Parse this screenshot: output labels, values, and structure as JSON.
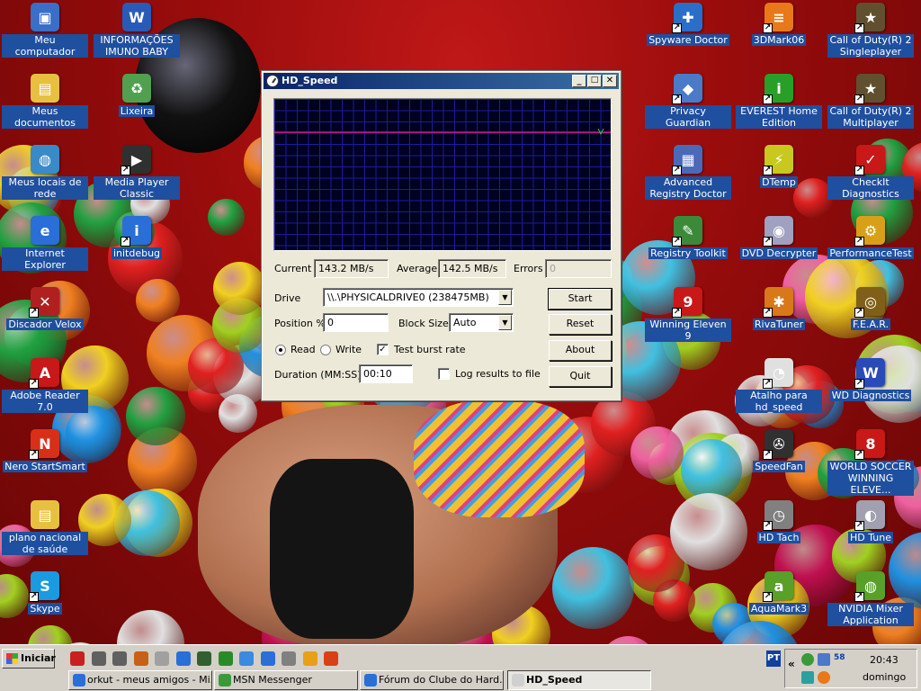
{
  "window": {
    "title": "HD_Speed",
    "btn_min": "_",
    "btn_max": "□",
    "btn_close": "✕",
    "current_label": "Current",
    "current_value": "143.2 MB/s",
    "average_label": "Average",
    "average_value": "142.5 MB/s",
    "errors_label": "Errors",
    "errors_value": "0",
    "drive_label": "Drive",
    "drive_value": "\\\\.\\PHYSICALDRIVE0 (238475MB)",
    "position_label": "Position %",
    "position_value": "0",
    "blocksize_label": "Block Size",
    "blocksize_value": "Auto",
    "read_label": "Read",
    "write_label": "Write",
    "burst_label": "Test burst rate",
    "duration_label": "Duration (MM:SS)",
    "duration_value": "00:10",
    "log_label": "Log results to file",
    "start_label": "Start",
    "reset_label": "Reset",
    "about_label": "About",
    "quit_label": "Quit",
    "mode_selected": "Read",
    "burst_checked": true,
    "log_checked": false,
    "graph_line_color": "#d01880",
    "graph_bg_color": "#000020",
    "graph_grid_color": "#1c1c9a"
  },
  "desktop_left": [
    {
      "label": "Meu computador",
      "icon": "computer-icon",
      "color": "#3a6ec8",
      "glyph": "▣",
      "shortcut": false
    },
    {
      "label": "Meus documentos",
      "icon": "folder-icon",
      "color": "#e8c040",
      "glyph": "▤",
      "shortcut": false
    },
    {
      "label": "Meus locais de rede",
      "icon": "network-icon",
      "color": "#3a8ac8",
      "glyph": "◍",
      "shortcut": false
    },
    {
      "label": "Internet Explorer",
      "icon": "internet-explorer-icon",
      "color": "#2a6ed8",
      "glyph": "e",
      "shortcut": false
    },
    {
      "label": "Discador Velox",
      "icon": "dialer-icon",
      "color": "#b02020",
      "glyph": "✕",
      "shortcut": true
    },
    {
      "label": "Adobe Reader 7.0",
      "icon": "adobe-reader-icon",
      "color": "#c81818",
      "glyph": "A",
      "shortcut": true
    },
    {
      "label": "Nero StartSmart",
      "icon": "nero-icon",
      "color": "#d83018",
      "glyph": "N",
      "shortcut": true
    },
    {
      "label": "plano nacional de saúde",
      "icon": "folder-icon",
      "color": "#e8c040",
      "glyph": "▤",
      "shortcut": false
    },
    {
      "label": "Skype",
      "icon": "skype-icon",
      "color": "#1a9ae0",
      "glyph": "S",
      "shortcut": true
    }
  ],
  "desktop_col2": [
    {
      "label": "INFORMAÇÕES IMUNO BABY",
      "icon": "word-document-icon",
      "color": "#2a5ab8",
      "glyph": "W",
      "shortcut": false
    },
    {
      "label": "Lixeira",
      "icon": "recycle-bin-icon",
      "color": "#50a050",
      "glyph": "♻",
      "shortcut": false
    },
    {
      "label": "Media Player Classic",
      "icon": "media-player-icon",
      "color": "#303030",
      "glyph": "▶",
      "shortcut": true
    },
    {
      "label": "initdebug",
      "icon": "info-icon",
      "color": "#2a6ed8",
      "glyph": "i",
      "shortcut": true
    }
  ],
  "desktop_right1": [
    {
      "label": "Spyware Doctor",
      "icon": "spyware-doctor-icon",
      "color": "#2a6ec8",
      "glyph": "✚",
      "shortcut": true
    },
    {
      "label": "Privacy Guardian",
      "icon": "privacy-guardian-icon",
      "color": "#4a7ac8",
      "glyph": "◆",
      "shortcut": true
    },
    {
      "label": "Advanced Registry Doctor",
      "icon": "registry-doctor-icon",
      "color": "#4a6ab8",
      "glyph": "▦",
      "shortcut": true
    },
    {
      "label": "Registry Toolkit",
      "icon": "registry-toolkit-icon",
      "color": "#3a8a3a",
      "glyph": "✎",
      "shortcut": true
    },
    {
      "label": "Winning Eleven 9",
      "icon": "winning-eleven-icon",
      "color": "#c81818",
      "glyph": "9",
      "shortcut": true
    }
  ],
  "desktop_right2": [
    {
      "label": "3DMark06",
      "icon": "3dmark-icon",
      "color": "#e87818",
      "glyph": "≡",
      "shortcut": true
    },
    {
      "label": "EVEREST Home Edition",
      "icon": "everest-icon",
      "color": "#28a028",
      "glyph": "i",
      "shortcut": true
    },
    {
      "label": "DTemp",
      "icon": "dtemp-icon",
      "color": "#c8c820",
      "glyph": "⚡",
      "shortcut": true
    },
    {
      "label": "DVD Decrypter",
      "icon": "dvd-decrypter-icon",
      "color": "#a0a0c0",
      "glyph": "◉",
      "shortcut": true
    },
    {
      "label": "RivaTuner",
      "icon": "rivatuner-icon",
      "color": "#d87818",
      "glyph": "✱",
      "shortcut": true
    },
    {
      "label": "Atalho para hd_speed",
      "icon": "hd-speed-icon",
      "color": "#e0e0e0",
      "glyph": "◔",
      "shortcut": true
    },
    {
      "label": "SpeedFan",
      "icon": "speedfan-icon",
      "color": "#303030",
      "glyph": "✇",
      "shortcut": true
    },
    {
      "label": "HD Tach",
      "icon": "hd-tach-icon",
      "color": "#808080",
      "glyph": "◷",
      "shortcut": true
    },
    {
      "label": "AquaMark3",
      "icon": "aquamark-icon",
      "color": "#58a028",
      "glyph": "a",
      "shortcut": true
    }
  ],
  "desktop_right3": [
    {
      "label": "Call of Duty(R) 2 Singleplayer",
      "icon": "call-of-duty-icon",
      "color": "#605030",
      "glyph": "★",
      "shortcut": true
    },
    {
      "label": "Call of Duty(R) 2 Multiplayer",
      "icon": "call-of-duty-icon",
      "color": "#605030",
      "glyph": "★",
      "shortcut": true
    },
    {
      "label": "CheckIt Diagnostics",
      "icon": "checkit-icon",
      "color": "#c81818",
      "glyph": "✓",
      "shortcut": true
    },
    {
      "label": "PerformanceTest",
      "icon": "performance-test-icon",
      "color": "#d8a018",
      "glyph": "⚙",
      "shortcut": true
    },
    {
      "label": "F.E.A.R.",
      "icon": "fear-icon",
      "color": "#806018",
      "glyph": "◎",
      "shortcut": true
    },
    {
      "label": "WD Diagnostics",
      "icon": "wd-diagnostics-icon",
      "color": "#2a4ab8",
      "glyph": "W",
      "shortcut": true
    },
    {
      "label": "WORLD SOCCER WINNING ELEVE...",
      "icon": "winning-eleven-icon",
      "color": "#c81818",
      "glyph": "8",
      "shortcut": true
    },
    {
      "label": "HD Tune",
      "icon": "hd-tune-icon",
      "color": "#a0a0b0",
      "glyph": "◐",
      "shortcut": true
    },
    {
      "label": "NVIDIA Mixer Application",
      "icon": "nvidia-mixer-icon",
      "color": "#58a028",
      "glyph": "◍",
      "shortcut": true
    }
  ],
  "taskbar": {
    "start_label": "Iniciar",
    "tasks": [
      {
        "label": "orkut - meus amigos - Mi...",
        "icon": "internet-explorer-icon",
        "color": "#2a6ed8",
        "active": false
      },
      {
        "label": "MSN Messenger",
        "icon": "msn-messenger-icon",
        "color": "#3a9a3a",
        "active": false
      },
      {
        "label": "Fórum do Clube do Hard...",
        "icon": "internet-explorer-icon",
        "color": "#2a6ed8",
        "active": false
      },
      {
        "label": "HD_Speed",
        "icon": "hd-speed-icon",
        "color": "#d0d0d0",
        "active": true
      }
    ],
    "lang": "PT",
    "tray_expand": "«",
    "tray_number": "58",
    "time": "20:43",
    "day": "domingo"
  }
}
